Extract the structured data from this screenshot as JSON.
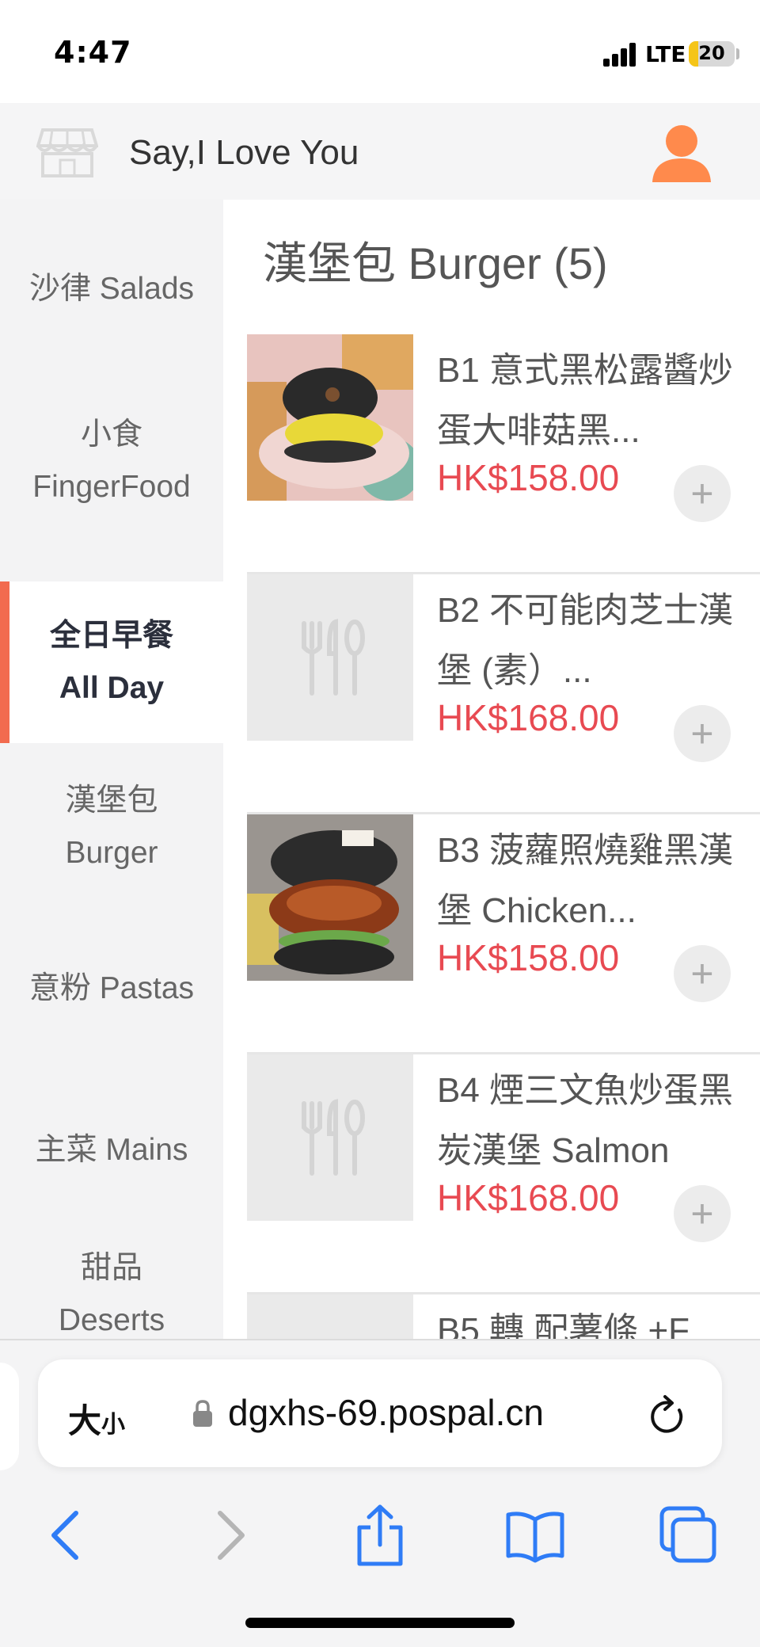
{
  "status_bar": {
    "time": "4:47",
    "network": "LTE",
    "battery": "20",
    "battery_level": 0.2
  },
  "header": {
    "shop_name": "Say,I Love You",
    "store_icon": "store-icon",
    "user_icon": "user-icon",
    "accent_color": "#ff8a4c"
  },
  "sidebar": {
    "items": [
      {
        "line1": "沙律 Salads",
        "line2": ""
      },
      {
        "line1": "小食",
        "line2": "FingerFood"
      },
      {
        "line1": "全日早餐",
        "line2": "All Day"
      },
      {
        "line1": "漢堡包",
        "line2": "Burger"
      },
      {
        "line1": "意粉 Pastas",
        "line2": ""
      },
      {
        "line1": "主菜 Mains",
        "line2": ""
      },
      {
        "line1": "甜品",
        "line2": "Deserts"
      }
    ],
    "active_index": 2,
    "active_color": "#f26b4f"
  },
  "main": {
    "section_title": "漢堡包 Burger (5)",
    "products": [
      {
        "name": "B1 意式黑松露醬炒蛋大啡菇黑...",
        "price": "HK$158.00",
        "image": "burger-photo"
      },
      {
        "name": "B2 不可能肉芝士漢堡 (素）...",
        "price": "HK$168.00",
        "image": "placeholder-cutlery"
      },
      {
        "name": "B3 菠蘿照燒雞黑漢堡 Chicken...",
        "price": "HK$158.00",
        "image": "burger-photo"
      },
      {
        "name": "B4 煙三文魚炒蛋黑炭漢堡 Salmon",
        "price": "HK$168.00",
        "image": "placeholder-cutlery"
      },
      {
        "name": "B5 轉 配薯條 +F",
        "price": "",
        "image": "placeholder"
      }
    ],
    "add_symbol": "+",
    "price_color": "#e84a52"
  },
  "browser": {
    "text_size_big": "大",
    "text_size_small": "小",
    "url": "dgxhs-69.pospal.cn",
    "accent_color": "#2f7cf6"
  }
}
